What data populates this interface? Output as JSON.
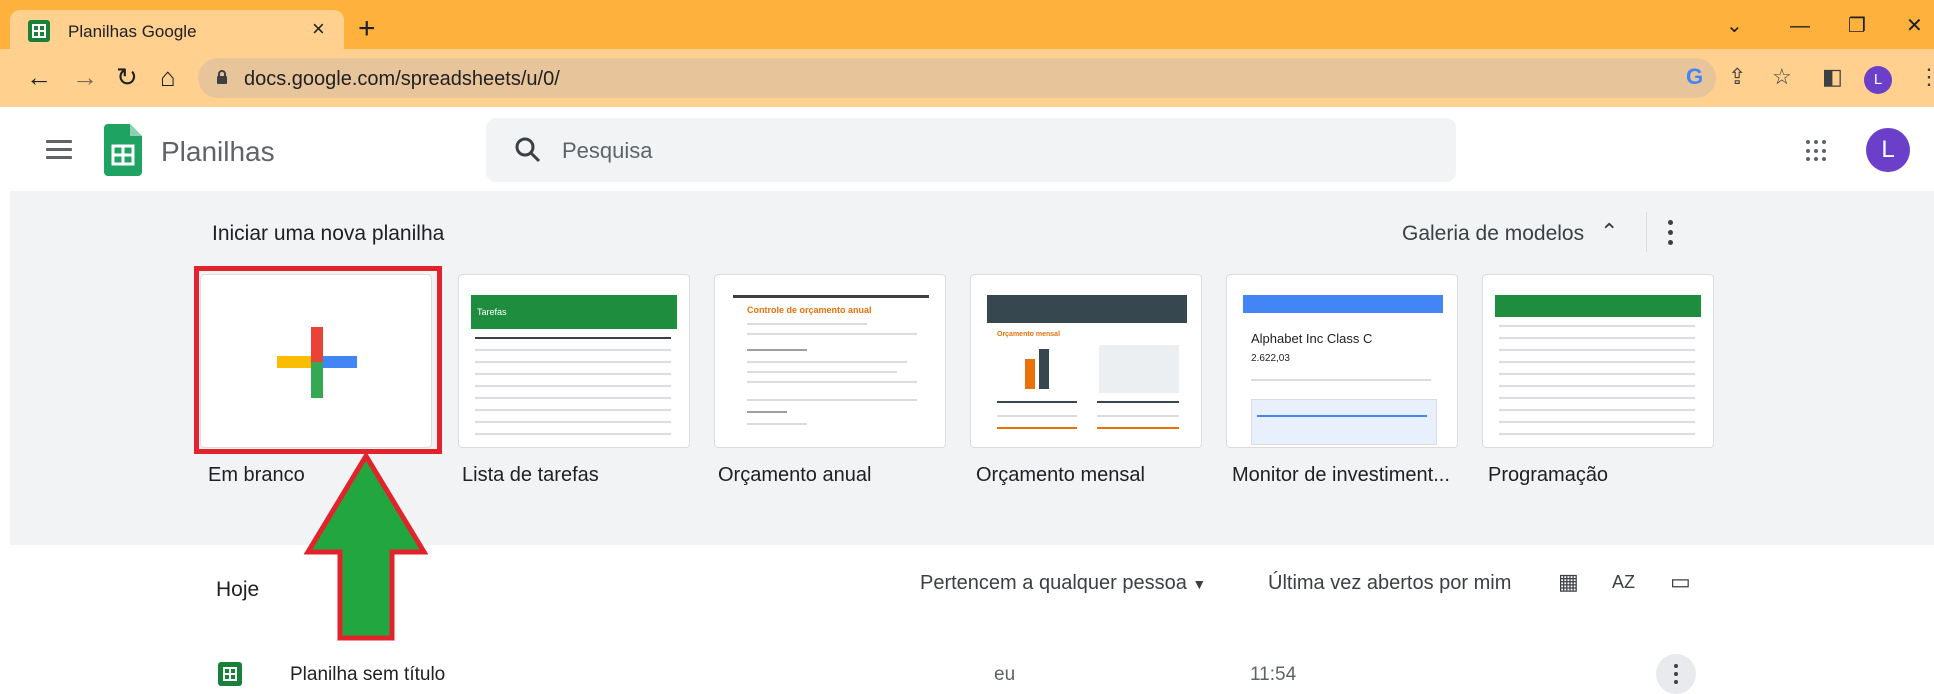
{
  "browser": {
    "tab_title": "Planilhas Google",
    "tab_close": "×",
    "new_tab": "+",
    "url": "docs.google.com/spreadsheets/u/0/",
    "profile_initial": "L",
    "window_controls": [
      "⌄",
      "—",
      "❐",
      "✕"
    ]
  },
  "app": {
    "title": "Planilhas",
    "search_placeholder": "Pesquisa",
    "avatar_initial": "L"
  },
  "templates": {
    "section_title": "Iniciar uma nova planilha",
    "gallery_label": "Galeria de modelos",
    "items": [
      {
        "label": "Em branco"
      },
      {
        "label": "Lista de tarefas",
        "thumb_title": "Tarefas"
      },
      {
        "label": "Orçamento anual",
        "thumb_title": "Controle de orçamento anual"
      },
      {
        "label": "Orçamento mensal",
        "thumb_title": "Orçamento mensal"
      },
      {
        "label": "Monitor de investiment...",
        "thumb_title": "Alphabet Inc Class C",
        "thumb_value": "2.622,03"
      },
      {
        "label": "Programação"
      }
    ]
  },
  "files": {
    "section_title": "Hoje",
    "filter_label": "Pertencem a qualquer pessoa",
    "sort_label": "Última vez abertos por mim",
    "rows": [
      {
        "name": "Planilha sem título",
        "owner": "eu",
        "time": "11:54"
      }
    ]
  },
  "colors": {
    "tabstrip": "#ffb13d",
    "toolbar": "#ffd08e",
    "sheets_green": "#188038",
    "highlight_red": "#e3232c",
    "arrow_green": "#22a63f",
    "avatar_purple": "#6b3fc9"
  }
}
